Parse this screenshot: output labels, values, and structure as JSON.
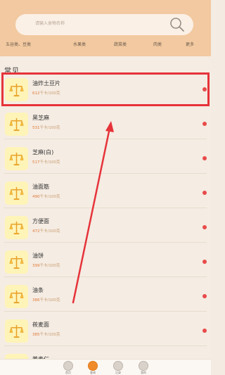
{
  "search": {
    "placeholder": "请输入食物名称"
  },
  "categories": [
    "五谷类、豆类",
    "水果类",
    "蔬菜类",
    "肉类",
    "更多"
  ],
  "section_title": "常见",
  "kcal_unit": "千卡/100克",
  "foods": [
    {
      "name": "油炸土豆片",
      "kcal": "612"
    },
    {
      "name": "黑芝麻",
      "kcal": "531"
    },
    {
      "name": "芝麻(白)",
      "kcal": "517"
    },
    {
      "name": "油面筋",
      "kcal": "490"
    },
    {
      "name": "方便面",
      "kcal": "472"
    },
    {
      "name": "油饼",
      "kcal": "399"
    },
    {
      "name": "油条",
      "kcal": "386"
    },
    {
      "name": "莜麦面",
      "kcal": "385"
    },
    {
      "name": "荞麦仁",
      "kcal": ""
    }
  ],
  "tabs": [
    {
      "label": "首页",
      "icon": "home-icon"
    },
    {
      "label": "查询",
      "icon": "search-food-icon"
    },
    {
      "label": "记录",
      "icon": "record-icon"
    },
    {
      "label": "我的",
      "icon": "profile-icon"
    }
  ],
  "colors": {
    "header_bg": "#f2c9a0",
    "highlight": "#e6333a",
    "dot": "#e84a4a",
    "accent": "#f08b2c"
  }
}
